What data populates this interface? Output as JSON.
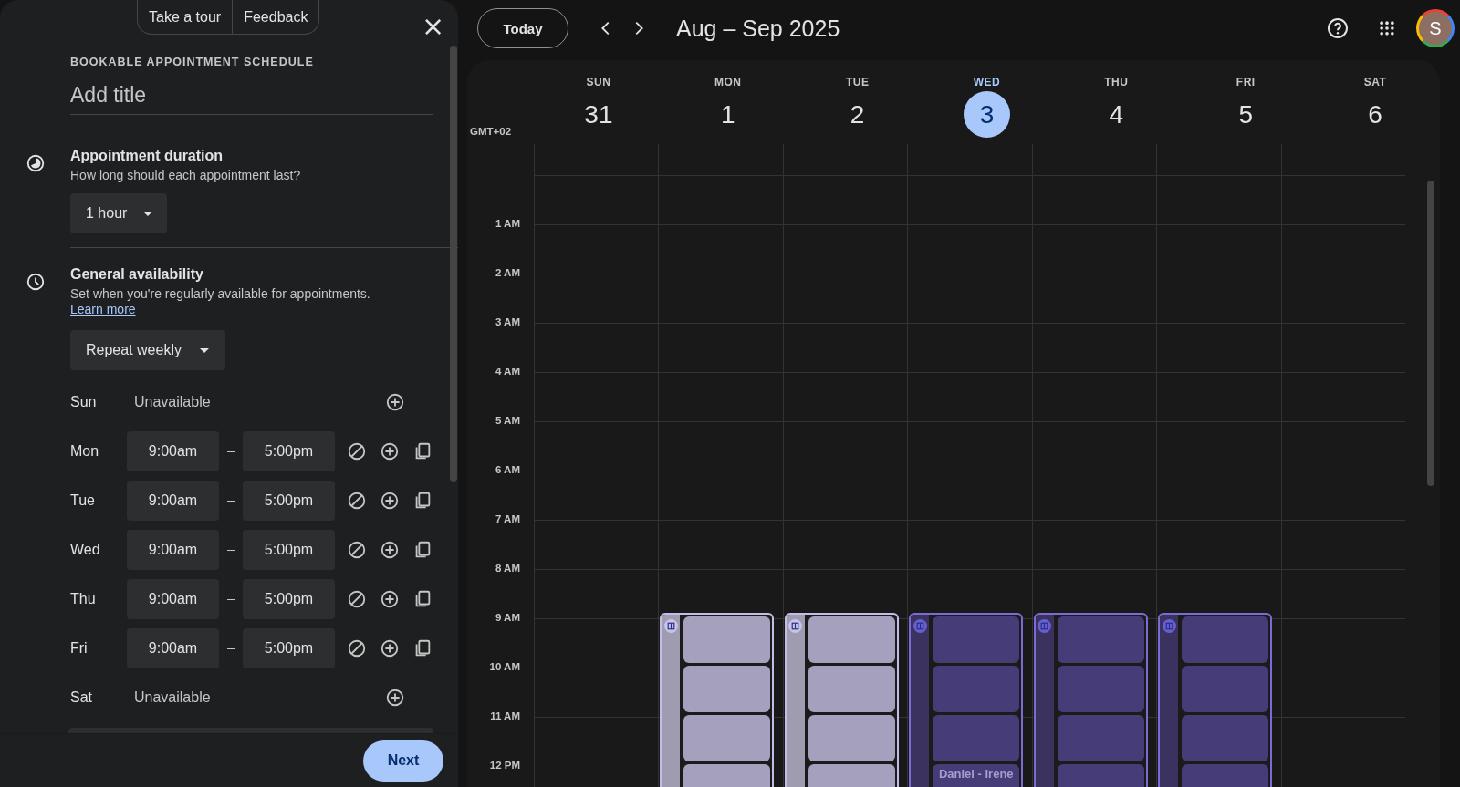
{
  "panel": {
    "top_links": [
      "Take a tour",
      "Feedback"
    ],
    "close": "×",
    "heading": "BOOKABLE APPOINTMENT SCHEDULE",
    "title_placeholder": "Add title",
    "duration": {
      "title": "Appointment duration",
      "subtitle": "How long should each appointment last?",
      "value": "1 hour"
    },
    "availability": {
      "title": "General availability",
      "subtitle": "Set when you're regularly available for appointments.",
      "link": "Learn more",
      "repeat": "Repeat weekly",
      "days": [
        {
          "day": "Sun",
          "kind": "unavailable",
          "status": "Unavailable"
        },
        {
          "day": "Mon",
          "kind": "hours",
          "start": "9:00am",
          "end": "5:00pm"
        },
        {
          "day": "Tue",
          "kind": "hours",
          "start": "9:00am",
          "end": "5:00pm"
        },
        {
          "day": "Wed",
          "kind": "hours",
          "start": "9:00am",
          "end": "5:00pm"
        },
        {
          "day": "Thu",
          "kind": "hours",
          "start": "9:00am",
          "end": "5:00pm"
        },
        {
          "day": "Fri",
          "kind": "hours",
          "start": "9:00am",
          "end": "5:00pm"
        },
        {
          "day": "Sat",
          "kind": "unavailable",
          "status": "Unavailable"
        }
      ]
    },
    "next": "Next"
  },
  "toolbar": {
    "today": "Today",
    "range": "Aug – Sep 2025",
    "avatar": "S"
  },
  "calendar": {
    "timezone": "GMT+02",
    "days": [
      {
        "name": "SUN",
        "number": "31",
        "selected": false
      },
      {
        "name": "MON",
        "number": "1",
        "selected": false,
        "event": {
          "past": true,
          "slots": [
            {
              "kind": "open"
            },
            {
              "kind": "open"
            },
            {
              "kind": "open"
            },
            {
              "kind": "open"
            }
          ]
        }
      },
      {
        "name": "TUE",
        "number": "2",
        "selected": false,
        "event": {
          "past": true,
          "slots": [
            {
              "kind": "open"
            },
            {
              "kind": "open"
            },
            {
              "kind": "open"
            },
            {
              "kind": "open"
            }
          ]
        }
      },
      {
        "name": "WED",
        "number": "3",
        "selected": true,
        "event": {
          "past": false,
          "slots": [
            {
              "kind": "open"
            },
            {
              "kind": "open"
            },
            {
              "kind": "open"
            },
            {
              "kind": "open",
              "label": "Daniel - Irene"
            }
          ]
        }
      },
      {
        "name": "THU",
        "number": "4",
        "selected": false,
        "event": {
          "past": false,
          "slots": [
            {
              "kind": "open"
            },
            {
              "kind": "open"
            },
            {
              "kind": "open"
            },
            {
              "kind": "open"
            }
          ]
        }
      },
      {
        "name": "FRI",
        "number": "5",
        "selected": false,
        "event": {
          "past": false,
          "slots": [
            {
              "kind": "open"
            },
            {
              "kind": "open"
            },
            {
              "kind": "open"
            },
            {
              "kind": "open"
            }
          ]
        }
      },
      {
        "name": "SAT",
        "number": "6",
        "selected": false
      }
    ],
    "hours": [
      "1 AM",
      "2 AM",
      "3 AM",
      "4 AM",
      "5 AM",
      "6 AM",
      "7 AM",
      "8 AM",
      "9 AM",
      "10 AM",
      "11 AM",
      "12 PM"
    ]
  }
}
